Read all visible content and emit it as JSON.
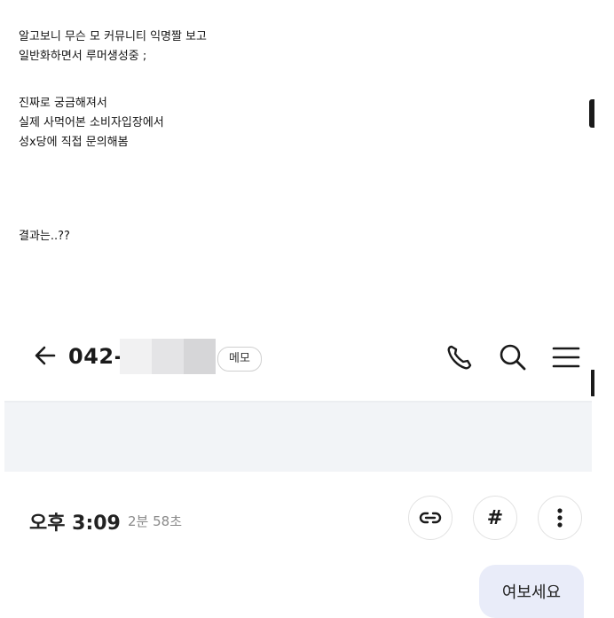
{
  "post": {
    "lines": [
      "알고보니 무슨 모 커뮤니티 익명짤 보고",
      "일반화하면서 루머생성중 ;",
      "진짜로 궁금해져서",
      "실제 사먹어본 소비자입장에서",
      "성x당에 직접 문의해봄",
      "결과는..??"
    ]
  },
  "call_screen": {
    "phone_number_visible": "042-",
    "memo_label": "메모",
    "icons": {
      "back": "arrow-left-icon",
      "call": "phone-icon",
      "search": "search-icon",
      "menu": "hamburger-menu-icon",
      "link": "link-icon",
      "tag": "hash-icon",
      "more": "more-vertical-icon"
    },
    "record": {
      "time": "오후 3:09",
      "duration": "2분 58초",
      "hash_label": "#"
    },
    "transcript": [
      {
        "speaker": "me",
        "text": "여보세요"
      }
    ]
  },
  "colors": {
    "band": "#f2f4f7",
    "bubble": "#e9ecf9",
    "text": "#111111",
    "muted": "#8a8a8a"
  }
}
